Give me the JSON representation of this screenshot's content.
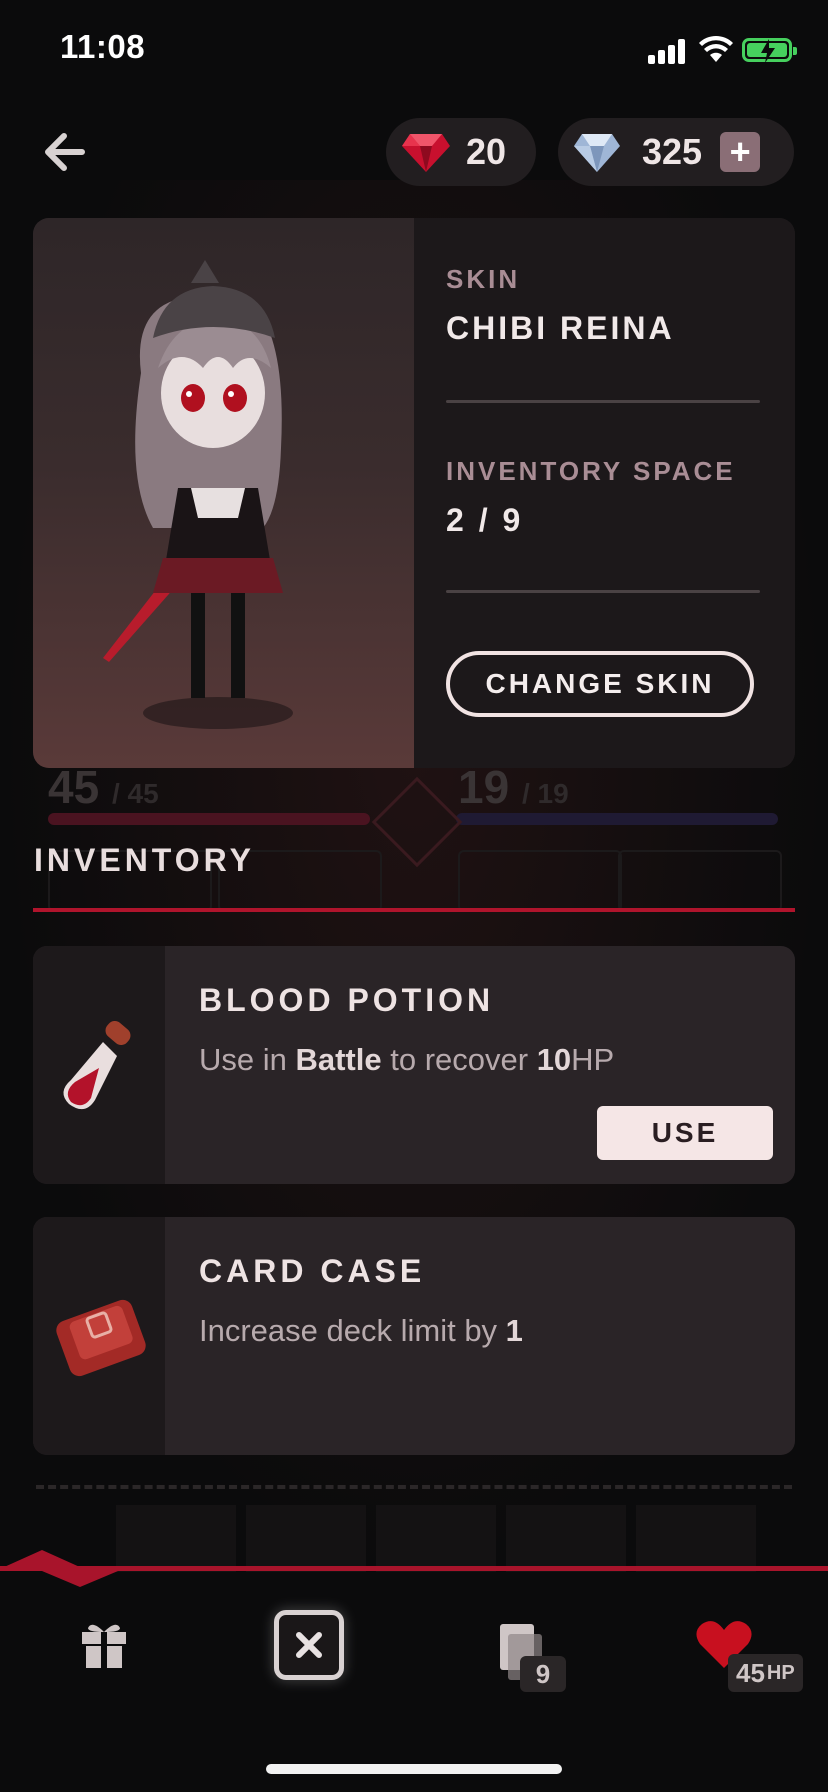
{
  "status_bar": {
    "time": "11:08"
  },
  "header": {
    "ruby_count": "20",
    "diamond_count": "325",
    "add_label": "+"
  },
  "skin_panel": {
    "skin_label": "SKIN",
    "skin_name": "CHIBI REINA",
    "inventory_space_label": "INVENTORY SPACE",
    "inventory_space_value": "2 / 9",
    "change_skin_label": "CHANGE SKIN"
  },
  "background_game": {
    "hp_value": "45",
    "hp_max": "/ 45",
    "energy_value": "19",
    "energy_max": "/ 19"
  },
  "inventory": {
    "title": "INVENTORY",
    "items": [
      {
        "name": "BLOOD POTION",
        "desc_parts": [
          "Use in ",
          "Battle",
          " to recover ",
          "10",
          "HP"
        ],
        "action_label": "USE"
      },
      {
        "name": "CARD CASE",
        "desc_parts": [
          "Increase deck limit by ",
          "1"
        ]
      }
    ]
  },
  "bottom_nav": {
    "deck_count": "9",
    "hp_value": "45",
    "hp_unit": "HP"
  },
  "colors": {
    "accent_red": "#b0142c",
    "battery_green": "#46d05e",
    "card_bg": "#2a2427"
  }
}
